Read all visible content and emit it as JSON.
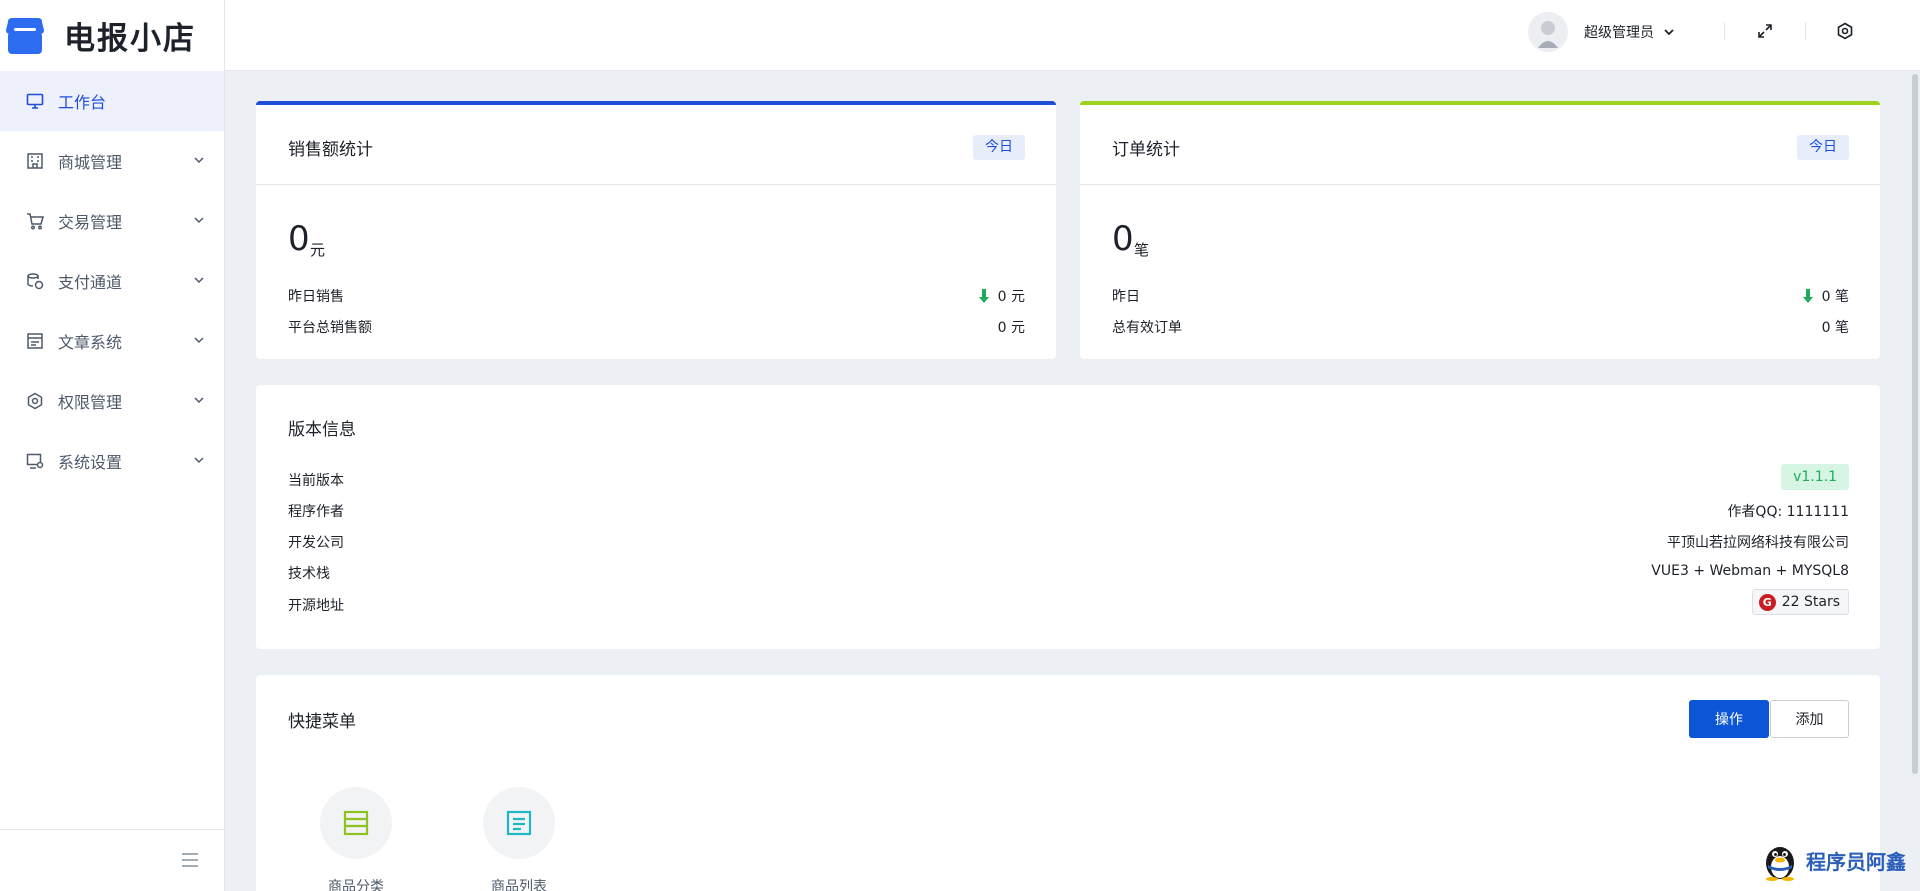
{
  "app": {
    "logo_text": "电报小店"
  },
  "sidebar": {
    "items": [
      {
        "label": "工作台",
        "icon": "monitor-icon",
        "active": true
      },
      {
        "label": "商城管理",
        "icon": "building-icon"
      },
      {
        "label": "交易管理",
        "icon": "cart-icon"
      },
      {
        "label": "支付通道",
        "icon": "coins-icon"
      },
      {
        "label": "文章系统",
        "icon": "article-icon"
      },
      {
        "label": "权限管理",
        "icon": "gear-icon"
      },
      {
        "label": "系统设置",
        "icon": "screen-settings-icon"
      }
    ]
  },
  "header": {
    "user_name": "超级管理员"
  },
  "sales": {
    "title": "销售额统计",
    "tag": "今日",
    "value": "0",
    "unit": "元",
    "rows": [
      {
        "label": "昨日销售",
        "value": "0 元",
        "trend": "down"
      },
      {
        "label": "平台总销售额",
        "value": "0 元"
      }
    ]
  },
  "orders": {
    "title": "订单统计",
    "tag": "今日",
    "value": "0",
    "unit": "笔",
    "rows": [
      {
        "label": "昨日",
        "value": "0 笔",
        "trend": "down"
      },
      {
        "label": "总有效订单",
        "value": "0 笔"
      }
    ]
  },
  "version": {
    "title": "版本信息",
    "rows": [
      {
        "label": "当前版本",
        "value": "v1.1.1"
      },
      {
        "label": "程序作者",
        "value": "作者QQ: 1111111"
      },
      {
        "label": "开发公司",
        "value": "平顶山若拉网络科技有限公司"
      },
      {
        "label": "技术栈",
        "value": "VUE3 + Webman + MYSQL8"
      },
      {
        "label": "开源地址",
        "value": "22 Stars",
        "badge_letter": "G"
      }
    ]
  },
  "quick": {
    "title": "快捷菜单",
    "operate_label": "操作",
    "add_label": "添加",
    "items": [
      {
        "label": "商品分类",
        "color": "#8dc21f"
      },
      {
        "label": "商品列表",
        "color": "#1fb7c4"
      }
    ]
  },
  "watermark": {
    "text": "程序员阿鑫"
  },
  "colors": {
    "primary": "#0c55d6",
    "accent_blue": "#1e4fd8",
    "accent_green": "#9bd31f",
    "trend_down": "#1fab5a"
  }
}
